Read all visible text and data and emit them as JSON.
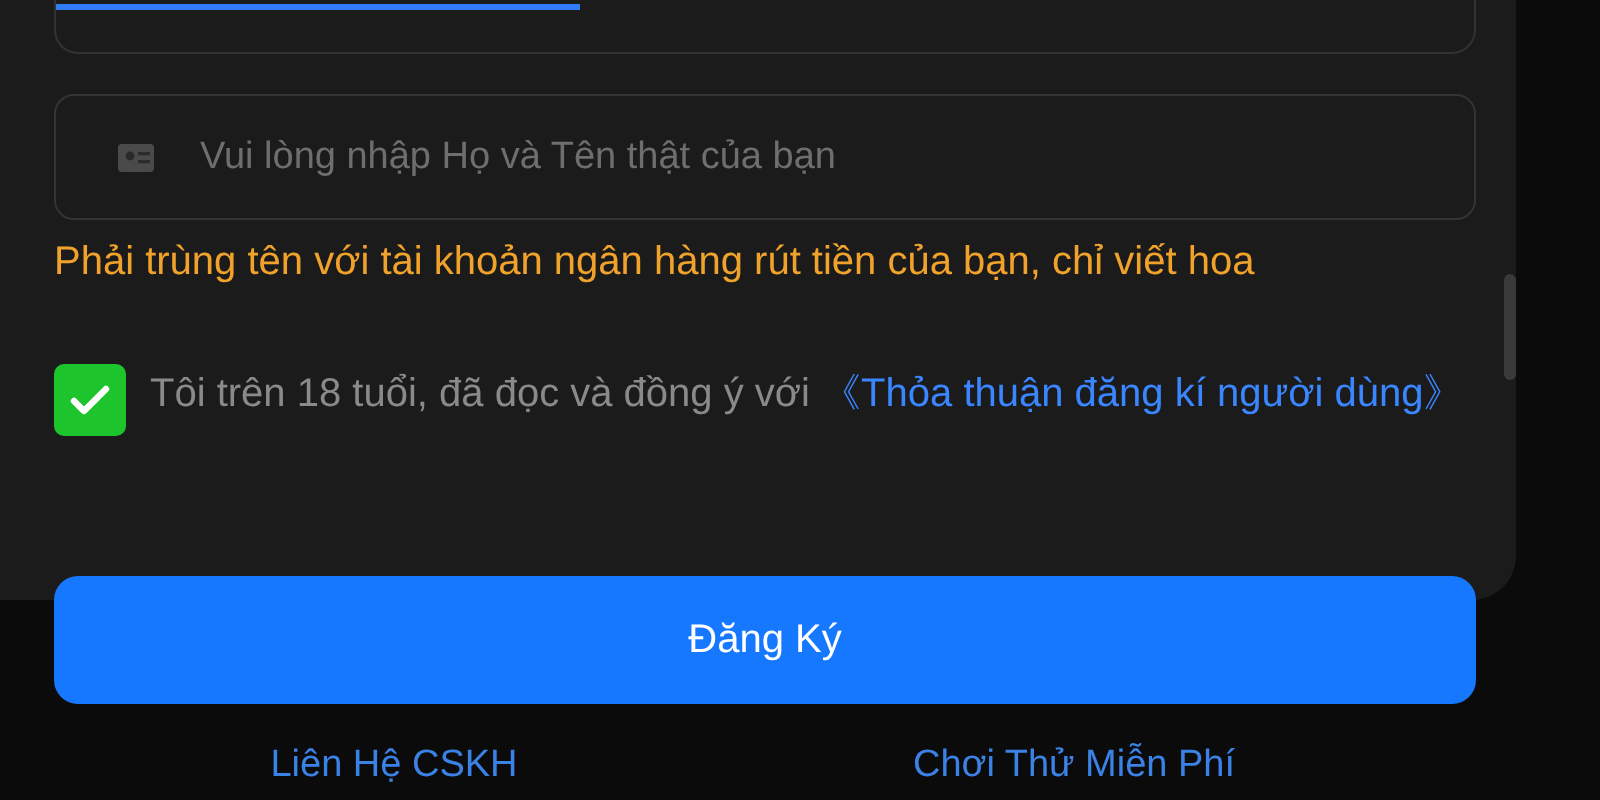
{
  "strength_bar": {
    "level": 0.37
  },
  "name_field": {
    "placeholder": "Vui lòng nhập Họ và Tên thật của bạn"
  },
  "warning": "Phải trùng tên với tài khoản ngân hàng rút tiền của bạn, chỉ viết hoa",
  "agreement": {
    "checked": true,
    "text": "Tôi trên 18 tuổi, đã đọc và đồng ý với",
    "link": "《Thỏa thuận đăng kí người dùng》"
  },
  "register_button": "Đăng Ký",
  "footer_links": [
    "Liên Hệ CSKH",
    "Chơi Thử Miễn Phí"
  ]
}
